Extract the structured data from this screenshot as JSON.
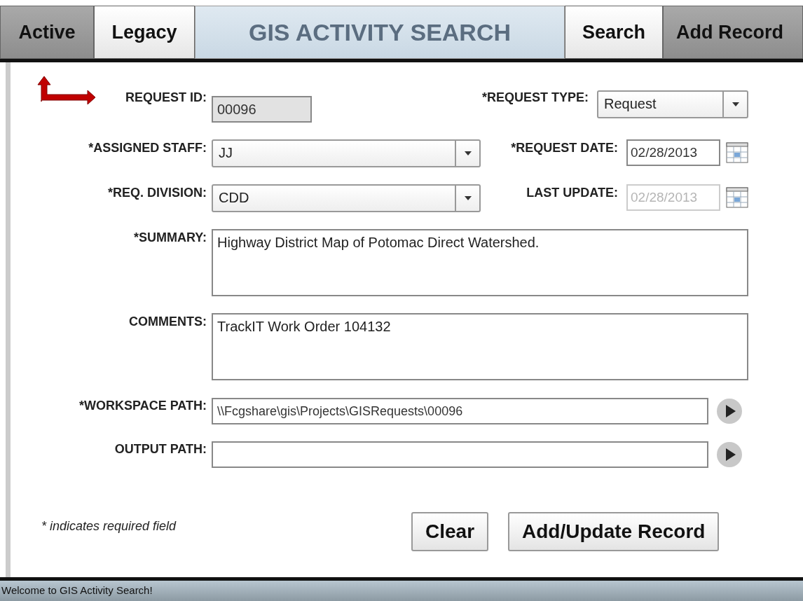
{
  "tabs_left": [
    {
      "label": "Active",
      "selected": false
    },
    {
      "label": "Legacy",
      "selected": true
    }
  ],
  "app_title": "GIS ACTIVITY SEARCH",
  "tabs_right": [
    {
      "label": "Search",
      "selected": true
    },
    {
      "label": "Add Record",
      "selected": false
    }
  ],
  "form_rows": [
    {
      "fields": [
        {
          "kind": "text",
          "label": "REQUEST ID:",
          "value": "00096",
          "disabled": true
        },
        {
          "kind": "select",
          "label": "*REQUEST TYPE:",
          "value": "Request"
        }
      ]
    },
    {
      "fields": [
        {
          "kind": "select",
          "label": "*ASSIGNED STAFF:",
          "value": "JJ"
        },
        {
          "kind": "date",
          "label": "*REQUEST DATE:",
          "value": "02/28/2013",
          "disabled": false
        }
      ]
    },
    {
      "fields": [
        {
          "kind": "select",
          "label": "*REQ. DIVISION:",
          "value": "CDD"
        },
        {
          "kind": "date",
          "label": "LAST UPDATE:",
          "value": "02/28/2013",
          "disabled": true
        }
      ]
    },
    {
      "fields": [
        {
          "kind": "textarea",
          "label": "*SUMMARY:",
          "value": "Highway District Map of Potomac Direct Watershed."
        }
      ]
    },
    {
      "fields": [
        {
          "kind": "textarea",
          "label": "COMMENTS:",
          "value": "TrackIT Work Order 104132"
        }
      ]
    },
    {
      "fields": [
        {
          "kind": "path",
          "label": "*WORKSPACE PATH:",
          "value": "\\\\Fcgshare\\gis\\Projects\\GISRequests\\00096"
        }
      ]
    },
    {
      "fields": [
        {
          "kind": "path",
          "label": "OUTPUT PATH:"
        }
      ]
    }
  ],
  "required_note": "* indicates required field",
  "buttons": [
    "Clear",
    "Add/Update Record"
  ],
  "status_bar": "Welcome to GIS Activity Search!"
}
